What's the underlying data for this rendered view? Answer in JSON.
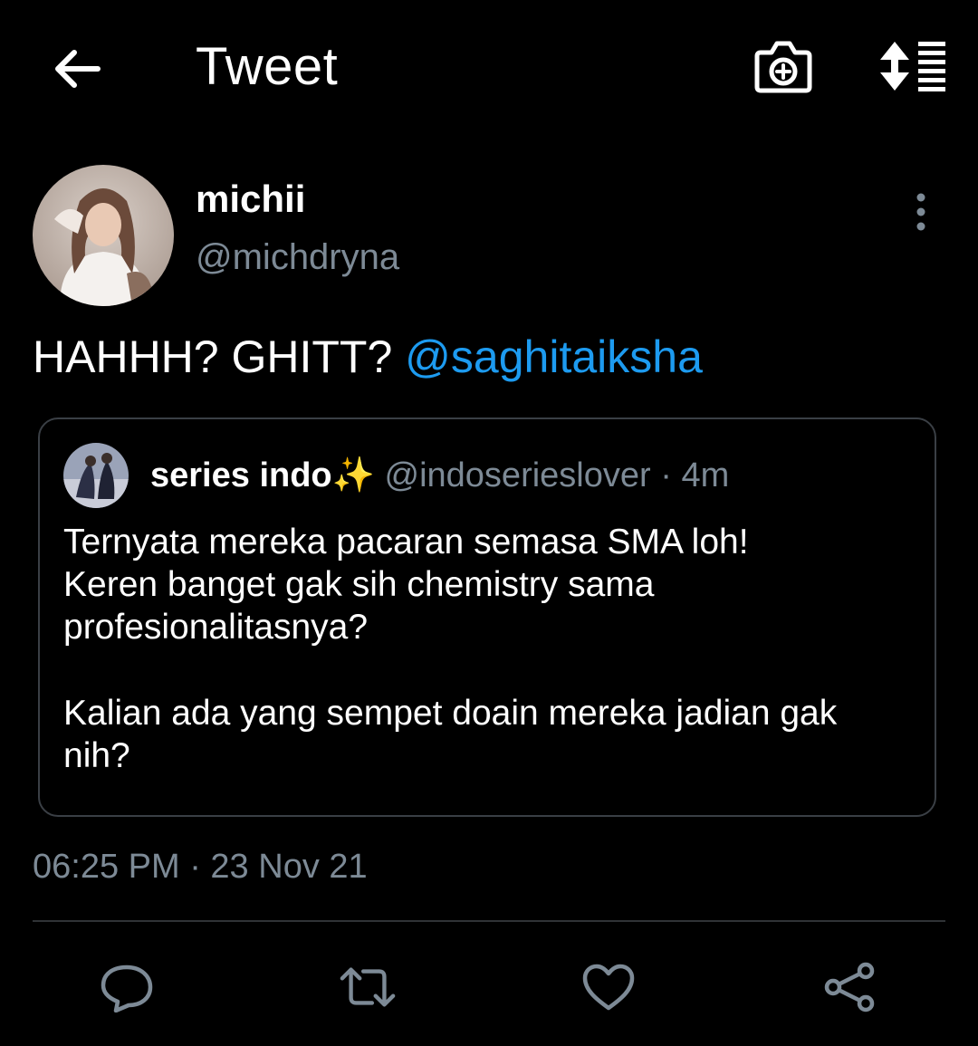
{
  "header": {
    "title": "Tweet",
    "back_icon": "arrow-left-icon",
    "camera_icon": "camera-plus-icon",
    "sort_icon": "sort-list-icon"
  },
  "tweet": {
    "author": {
      "display_name": "michii",
      "handle": "@michdryna"
    },
    "text": "HAHHH? GHITT?",
    "mention": "@saghitaiksha",
    "timestamp": "06:25 PM · 23 Nov 21"
  },
  "quoted_tweet": {
    "display_name": "series indo✨",
    "handle": "@indoserieslover",
    "time": "· 4m",
    "paragraph_1": [
      "Ternyata mereka pacaran semasa SMA loh!",
      "Keren banget gak sih chemistry sama",
      "profesionalitasnya?"
    ],
    "paragraph_2": [
      "Kalian ada yang sempet doain mereka jadian gak",
      "nih?"
    ]
  },
  "actions": {
    "reply_icon": "reply-icon",
    "retweet_icon": "retweet-icon",
    "like_icon": "heart-icon",
    "share_icon": "share-icon"
  },
  "colors": {
    "background": "#000000",
    "accent": "#1d9bf0",
    "secondary_text": "#7d8a96",
    "border": "#3a3f45"
  }
}
